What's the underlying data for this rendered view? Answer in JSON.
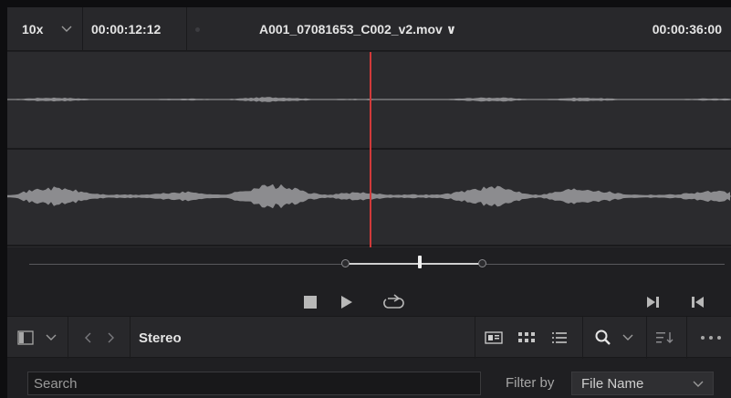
{
  "viewer": {
    "zoom": "10x",
    "current_timecode": "00:00:12:12",
    "clip_name": "A001_07081653_C002_v2.mov ∨",
    "duration_timecode": "00:00:36:00"
  },
  "transport": {
    "scrub_position": 0.57,
    "range_start": 0.47,
    "range_end": 0.66
  },
  "media_pool": {
    "current_bin": "Stereo",
    "search_placeholder": "Search",
    "filter_label": "Filter by",
    "filter_value": "File Name"
  },
  "icons": {
    "caret": "chevron-down-icon",
    "nav_back": "chevron-left-icon",
    "nav_forward": "chevron-right-icon",
    "sidebar_toggle": "sidebar-icon",
    "metadata_view": "metadata-view-icon",
    "thumbnail_view": "thumbnail-view-icon",
    "list_view": "list-view-icon",
    "search": "search-icon",
    "sort": "sort-icon",
    "more": "more-icon",
    "stop": "stop-icon",
    "play": "play-icon",
    "loop": "loop-icon",
    "next_frame": "next-frame-icon",
    "prev_frame": "prev-frame-icon"
  },
  "colors": {
    "playhead": "#d23a3a",
    "waveform": "#8c8c8f",
    "background": "#1f1f22"
  }
}
